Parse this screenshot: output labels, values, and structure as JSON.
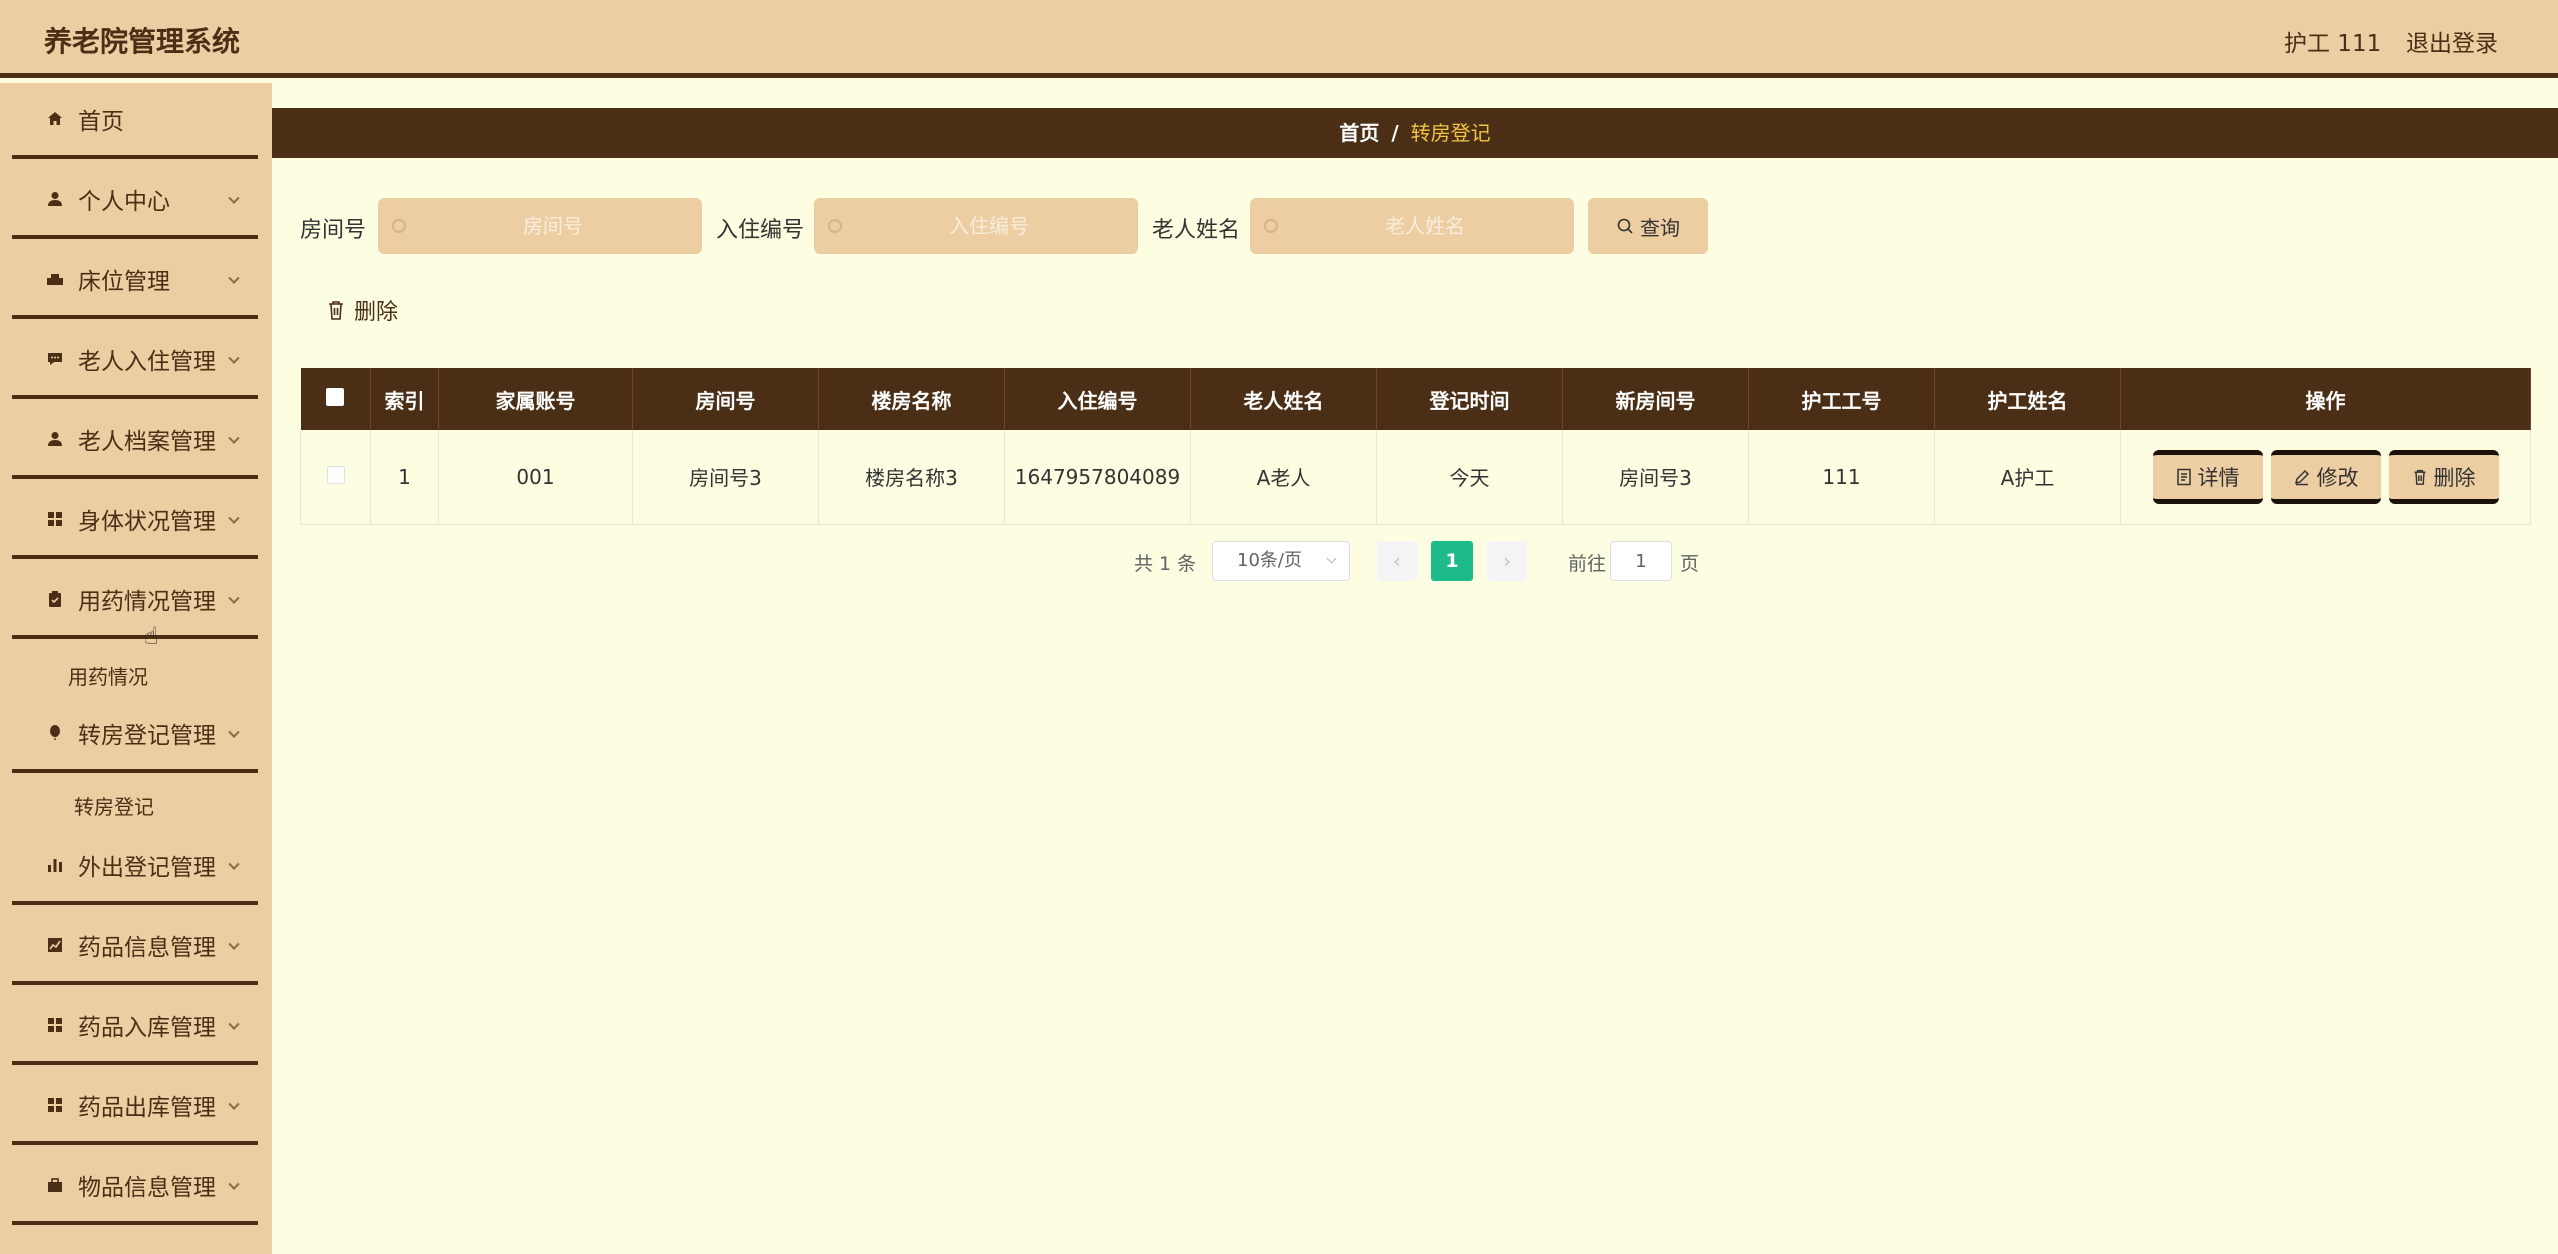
{
  "header": {
    "app_title": "养老院管理系统",
    "user": "护工 111",
    "logout": "退出登录"
  },
  "sidebar": {
    "items": [
      {
        "label": "首页",
        "icon": "home-icon"
      },
      {
        "label": "个人中心",
        "icon": "user-icon"
      },
      {
        "label": "床位管理",
        "icon": "bed-icon"
      },
      {
        "label": "老人入住管理",
        "icon": "chat-icon"
      },
      {
        "label": "老人档案管理",
        "icon": "user-icon"
      },
      {
        "label": "身体状况管理",
        "icon": "grid-icon"
      },
      {
        "label": "用药情况管理",
        "icon": "clipboard-icon"
      },
      {
        "label": "转房登记管理",
        "icon": "balloon-icon"
      },
      {
        "label": "外出登记管理",
        "icon": "bar-chart-icon"
      },
      {
        "label": "药品信息管理",
        "icon": "line-chart-icon"
      },
      {
        "label": "药品入库管理",
        "icon": "grid-icon"
      },
      {
        "label": "药品出库管理",
        "icon": "grid-icon"
      },
      {
        "label": "物品信息管理",
        "icon": "briefcase-icon"
      }
    ],
    "sub_medication": "用药情况",
    "sub_transfer": "转房登记"
  },
  "breadcrumb": {
    "home": "首页",
    "separator": "/",
    "current": "转房登记"
  },
  "search": {
    "room_label": "房间号",
    "room_placeholder": "房间号",
    "checkin_label": "入住编号",
    "checkin_placeholder": "入住编号",
    "elder_label": "老人姓名",
    "elder_placeholder": "老人姓名",
    "query_label": "查询"
  },
  "toolbar": {
    "delete_label": "删除"
  },
  "table": {
    "columns": [
      "索引",
      "家属账号",
      "房间号",
      "楼房名称",
      "入住编号",
      "老人姓名",
      "登记时间",
      "新房间号",
      "护工工号",
      "护工姓名",
      "操作"
    ],
    "rows": [
      {
        "index": "1",
        "family_account": "001",
        "room": "房间号3",
        "building": "楼房名称3",
        "checkin_no": "1647957804089",
        "elder_name": "A老人",
        "register_time": "今天",
        "new_room": "房间号3",
        "nurse_id": "111",
        "nurse_name": "A护工"
      }
    ],
    "actions": {
      "detail": "详情",
      "edit": "修改",
      "delete": "删除"
    }
  },
  "pagination": {
    "total": "共 1 条",
    "page_size": "10条/页",
    "current_page": "1",
    "goto_prefix": "前往",
    "goto_value": "1",
    "goto_suffix": "页"
  },
  "colors": {
    "header_bg": "#edcea3",
    "accent_dark": "#4a2f16",
    "page_bg": "#fdfde2",
    "breadcrumb_active": "#f2c542",
    "pagination_active": "#1dbb8a"
  }
}
